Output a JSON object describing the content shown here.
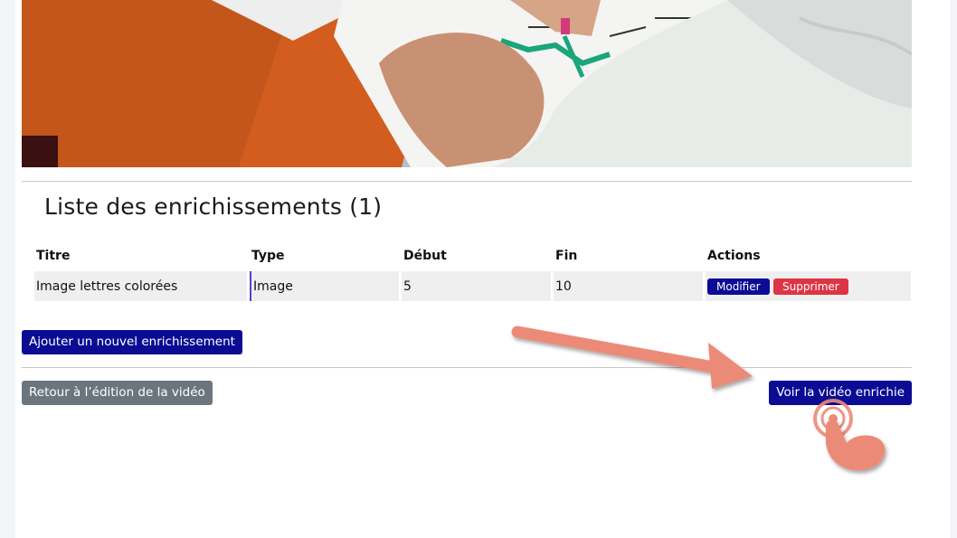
{
  "video": {
    "description_icon": "video-thumbnail"
  },
  "section": {
    "title": "Liste des enrichissements (1)"
  },
  "table": {
    "headers": [
      "Titre",
      "Type",
      "Début",
      "Fin",
      "Actions"
    ],
    "rows": [
      {
        "titre": "Image lettres colorées",
        "type": "Image",
        "debut": "5",
        "fin": "10",
        "modify_label": "Modifier",
        "delete_label": "Supprimer"
      }
    ]
  },
  "buttons": {
    "add_label": "Ajouter un nouvel enrichissement",
    "back_label": "Retour à l’édition de la vidéo",
    "view_label": "Voir la vidéo enrichie"
  },
  "colors": {
    "primary": "#0b0c93",
    "danger": "#dc3545",
    "secondary": "#6c757d",
    "annotation": "#ec8a78"
  }
}
